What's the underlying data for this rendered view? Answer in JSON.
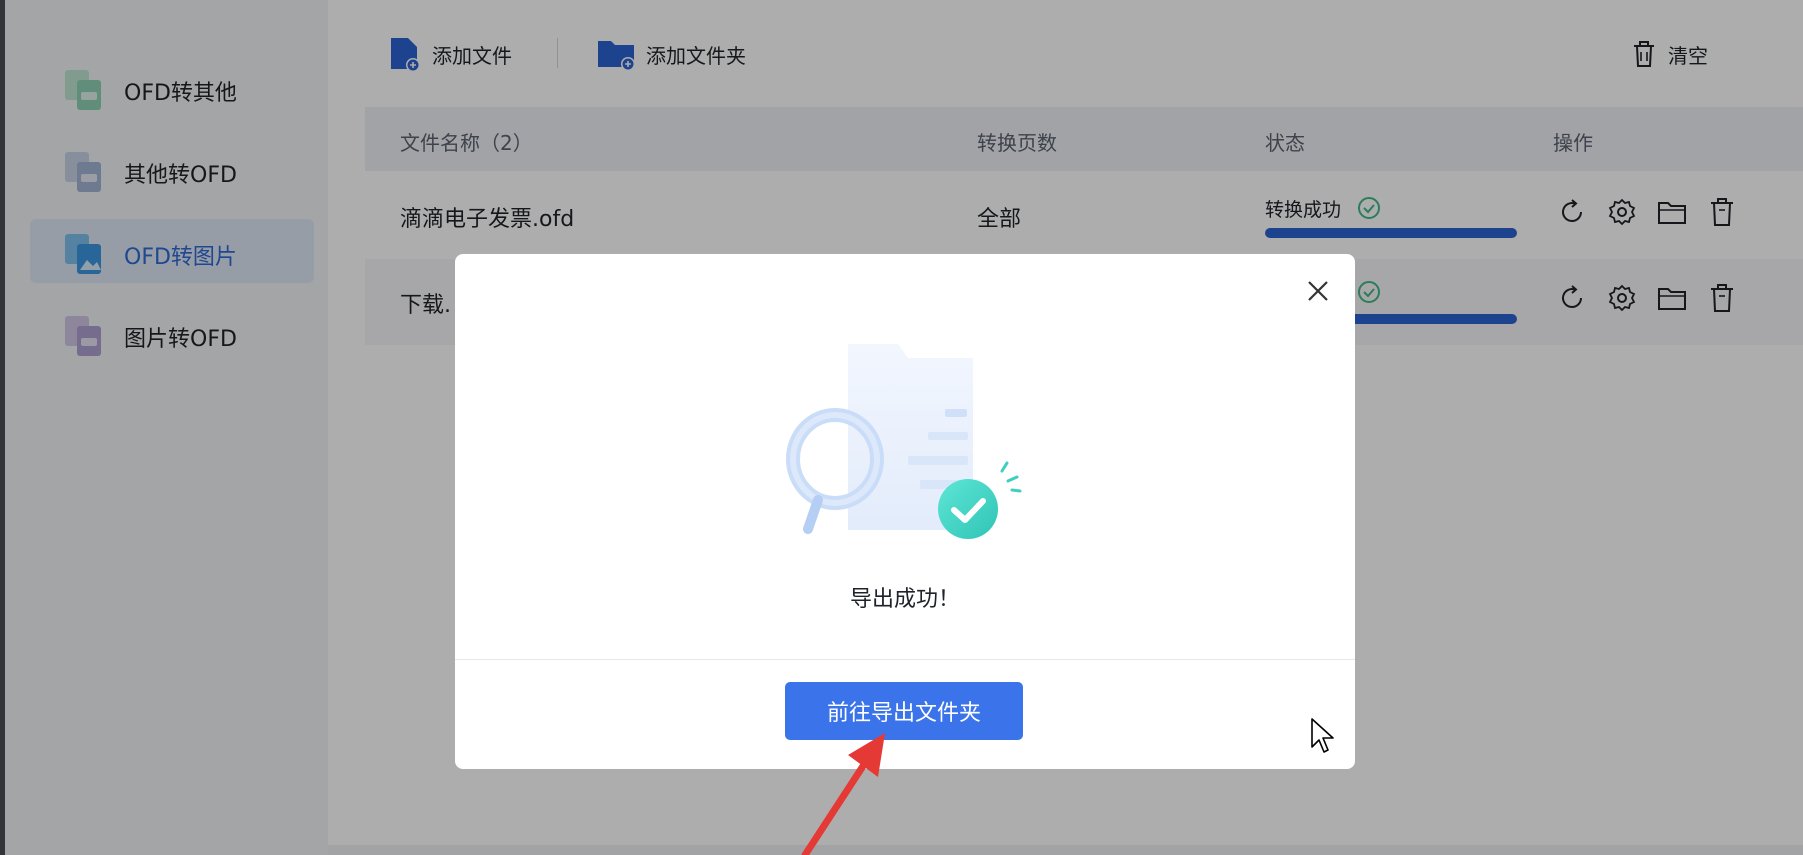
{
  "sidebar": {
    "items": [
      {
        "label": "OFD转其他",
        "icon": "ofd-to-other-icon"
      },
      {
        "label": "其他转OFD",
        "icon": "other-to-ofd-icon"
      },
      {
        "label": "OFD转图片",
        "icon": "ofd-to-image-icon",
        "active": true
      },
      {
        "label": "图片转OFD",
        "icon": "image-to-ofd-icon"
      }
    ]
  },
  "toolbar": {
    "add_file": "添加文件",
    "add_folder": "添加文件夹",
    "clear": "清空"
  },
  "table": {
    "headers": [
      "文件名称（2）",
      "转换页数",
      "状态",
      "操作"
    ],
    "rows": [
      {
        "name": "滴滴电子发票.ofd",
        "pages": "全部",
        "status": "转换成功",
        "progress": 1.0
      },
      {
        "name": "下载.",
        "pages": "",
        "status": "",
        "progress": 1.0
      }
    ]
  },
  "modal": {
    "message": "导出成功！",
    "button": "前往导出文件夹"
  },
  "colors": {
    "accent": "#3b74ea",
    "success": "#3ecfc0",
    "progress": "#2d63d1"
  }
}
